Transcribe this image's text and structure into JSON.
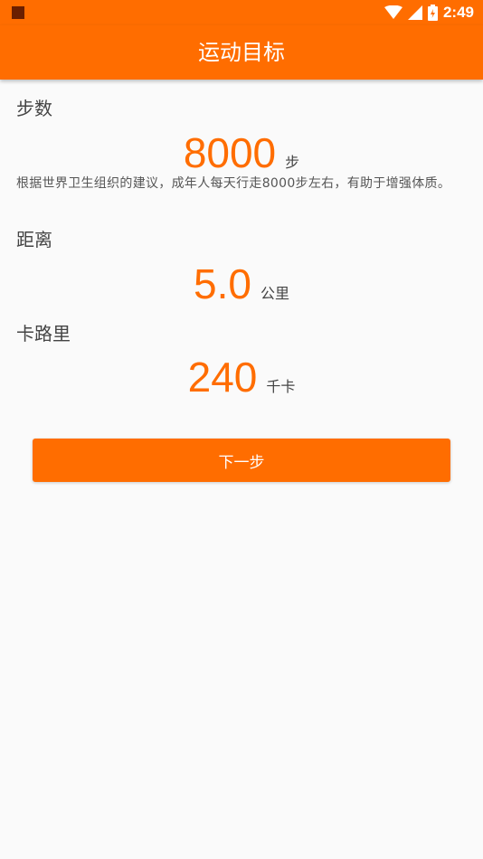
{
  "status_bar": {
    "time": "2:49",
    "icons": [
      "notification-square-icon",
      "wifi-icon",
      "cell-signal-icon",
      "battery-icon"
    ]
  },
  "app_bar": {
    "title": "运动目标"
  },
  "steps": {
    "label": "步数",
    "value": "8000",
    "unit": "步",
    "description": "根据世界卫生组织的建议，成年人每天行走8000步左右，有助于增强体质。"
  },
  "distance": {
    "label": "距离",
    "value": "5.0",
    "unit": "公里"
  },
  "calories": {
    "label": "卡路里",
    "value": "240",
    "unit": "千卡"
  },
  "next_button": {
    "label": "下一步"
  },
  "colors": {
    "accent": "#ff6d00",
    "background": "#fafafa",
    "text": "#444444"
  }
}
